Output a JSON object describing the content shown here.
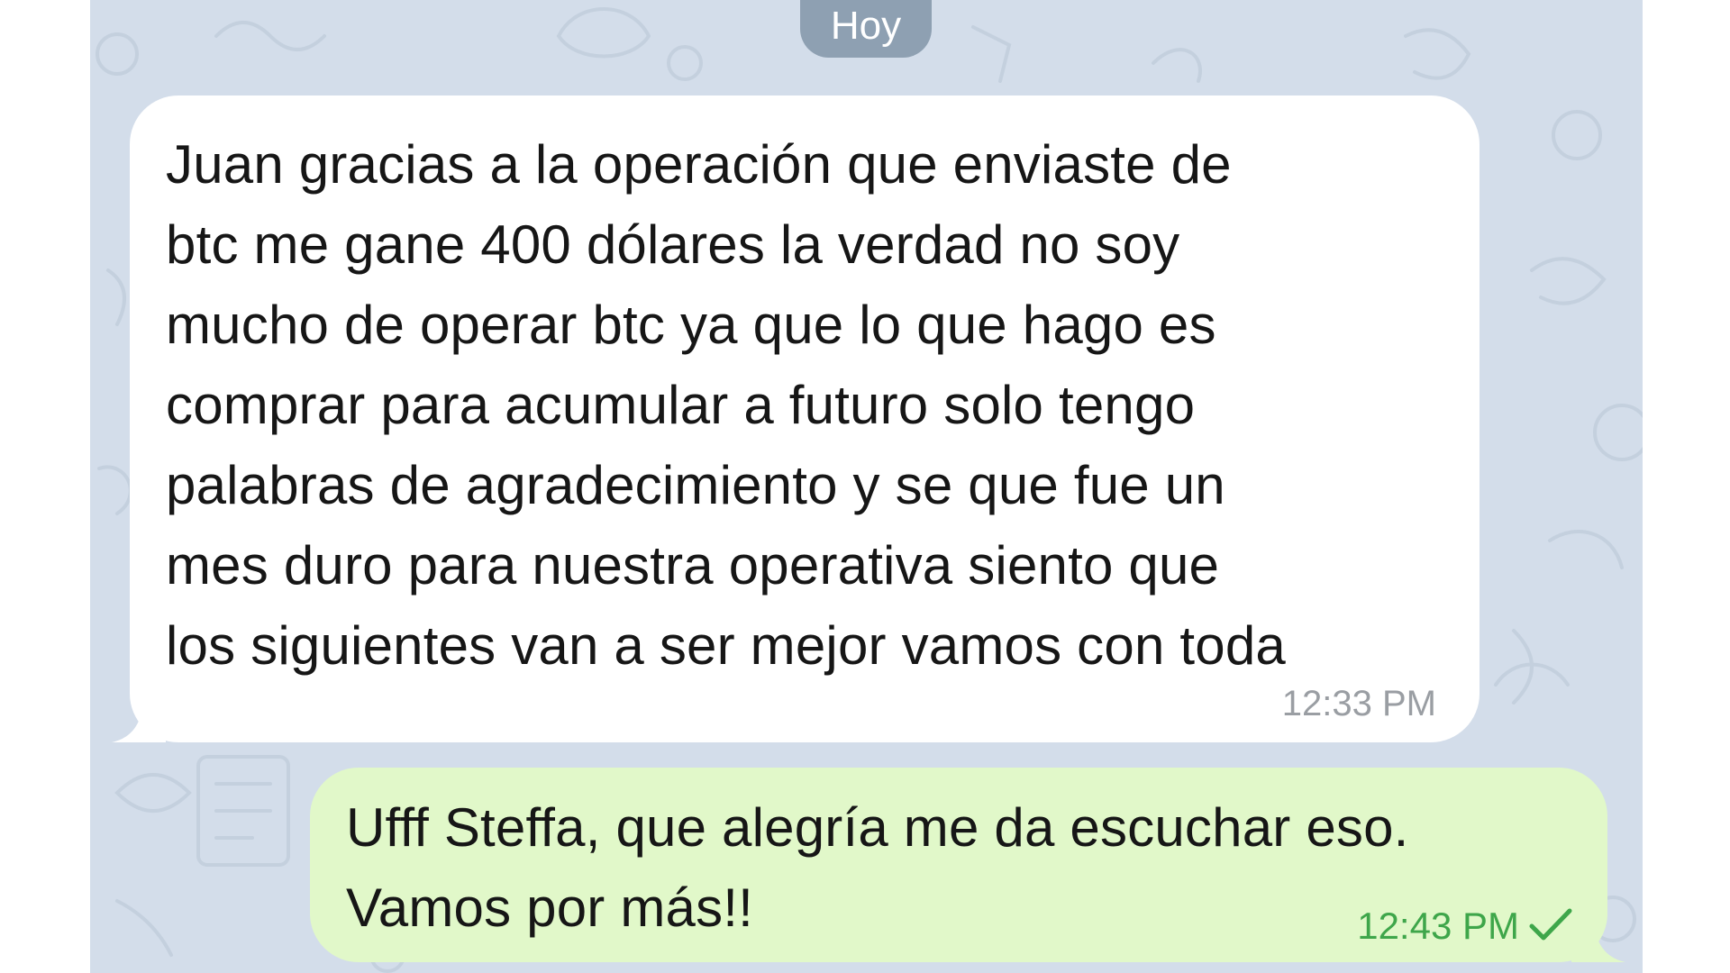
{
  "chat": {
    "date_separator": "Hoy",
    "messages": [
      {
        "direction": "incoming",
        "lines": [
          "Juan gracias a la operación que enviaste de",
          "btc me gane 400 dólares la verdad no soy",
          "mucho de operar btc ya que lo que hago es",
          "comprar para acumular a futuro solo tengo",
          "palabras de agradecimiento y se que fue un",
          "mes duro para nuestra operativa siento que",
          "los siguientes van a ser mejor vamos con toda"
        ],
        "time": "12:33 PM",
        "bubble_color": "#ffffff"
      },
      {
        "direction": "outgoing",
        "lines": [
          "Ufff Steffa, que alegría me da escuchar eso.",
          "Vamos por más!!"
        ],
        "time": "12:43 PM",
        "status_icon": "single-check-icon",
        "bubble_color": "#e1f8c9"
      }
    ]
  },
  "colors": {
    "background": "#d3ddea",
    "date_pill": "#8ea0b2",
    "outgoing_time": "#3ea64a",
    "incoming_time": "#9a9ea3"
  }
}
